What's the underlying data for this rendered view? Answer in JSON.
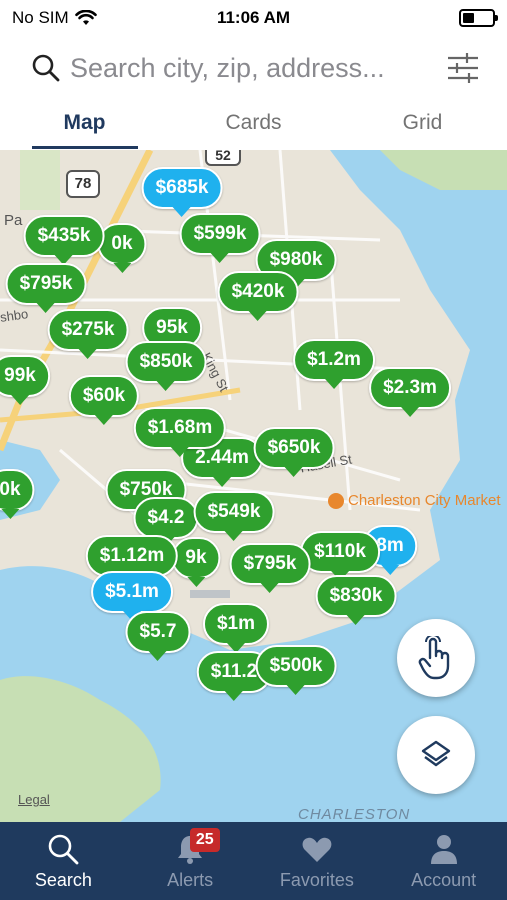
{
  "status_bar": {
    "carrier": "No SIM",
    "time": "11:06 AM"
  },
  "search": {
    "placeholder": "Search city, zip, address..."
  },
  "tabs": [
    {
      "label": "Map",
      "active": true
    },
    {
      "label": "Cards",
      "active": false
    },
    {
      "label": "Grid",
      "active": false
    }
  ],
  "map": {
    "road_labels": [
      "78",
      "52",
      "King St",
      "Hasell St"
    ],
    "place_labels": [
      "Charleston City Market",
      "CHARLESTON",
      "Legal"
    ],
    "partial_labels": [
      "Pa",
      "shbo"
    ],
    "price_pins": [
      {
        "label": "$685k",
        "color": "blue"
      },
      {
        "label": "$435k",
        "color": "green"
      },
      {
        "label": "0k",
        "color": "green"
      },
      {
        "label": "$599k",
        "color": "green"
      },
      {
        "label": "$980k",
        "color": "green"
      },
      {
        "label": "$795k",
        "color": "green"
      },
      {
        "label": "$420k",
        "color": "green"
      },
      {
        "label": "$275k",
        "color": "green"
      },
      {
        "label": "95k",
        "color": "green"
      },
      {
        "label": "$850k",
        "color": "green"
      },
      {
        "label": "99k",
        "color": "green"
      },
      {
        "label": "$60k",
        "color": "green"
      },
      {
        "label": "$1.2m",
        "color": "green"
      },
      {
        "label": "$2.3m",
        "color": "green"
      },
      {
        "label": "$1.68m",
        "color": "green"
      },
      {
        "label": "$650k",
        "color": "green"
      },
      {
        "label": "2.44m",
        "color": "green"
      },
      {
        "label": "0k",
        "color": "green"
      },
      {
        "label": "$750k",
        "color": "green"
      },
      {
        "label": "$4.2",
        "color": "green"
      },
      {
        "label": "$549k",
        "color": "green"
      },
      {
        "label": "8m",
        "color": "blue"
      },
      {
        "label": "$110k",
        "color": "green"
      },
      {
        "label": "$1.12m",
        "color": "green"
      },
      {
        "label": "9k",
        "color": "green"
      },
      {
        "label": "$795k",
        "color": "green"
      },
      {
        "label": "$5.1m",
        "color": "blue"
      },
      {
        "label": "$830k",
        "color": "green"
      },
      {
        "label": "$5.7",
        "color": "green"
      },
      {
        "label": "$1m",
        "color": "green"
      },
      {
        "label": "$11.2",
        "color": "green"
      },
      {
        "label": "$500k",
        "color": "green"
      }
    ]
  },
  "bottom_nav": [
    {
      "label": "Search",
      "icon": "search-icon",
      "active": true
    },
    {
      "label": "Alerts",
      "icon": "bell-icon",
      "active": false,
      "badge": "25"
    },
    {
      "label": "Favorites",
      "icon": "heart-icon",
      "active": false
    },
    {
      "label": "Account",
      "icon": "person-icon",
      "active": false
    }
  ],
  "colors": {
    "pin_green": "#2fa02e",
    "pin_blue": "#1fb1ee",
    "nav_bg": "#1f3a5e",
    "tab_active": "#203a5f",
    "water": "#9fd3ef",
    "land": "#e9e4d9"
  }
}
